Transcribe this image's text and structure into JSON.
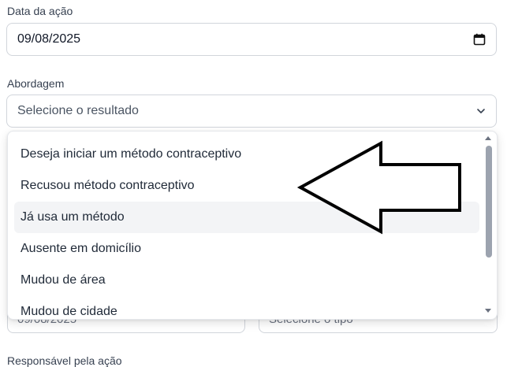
{
  "date_field": {
    "label": "Data da ação",
    "value": "09/08/2025",
    "icon": "calendar-icon"
  },
  "abordagem": {
    "label": "Abordagem",
    "placeholder": "Selecione o resultado",
    "icon": "chevron-down-icon"
  },
  "dropdown": {
    "options": [
      "Deseja iniciar um método contraceptivo",
      "Recusou método contraceptivo",
      "Já usa um método",
      "Ausente em domicílio",
      "Mudou de área",
      "Mudou de cidade"
    ],
    "highlighted_index": 2
  },
  "hidden_row": {
    "left_text": "09/08/2025",
    "right_text": "Selecione o tipo"
  },
  "responsavel": {
    "label": "Responsável pela ação"
  },
  "colors": {
    "border": "#d1d5db",
    "highlight": "#f3f4f6",
    "text": "#1f2937"
  }
}
